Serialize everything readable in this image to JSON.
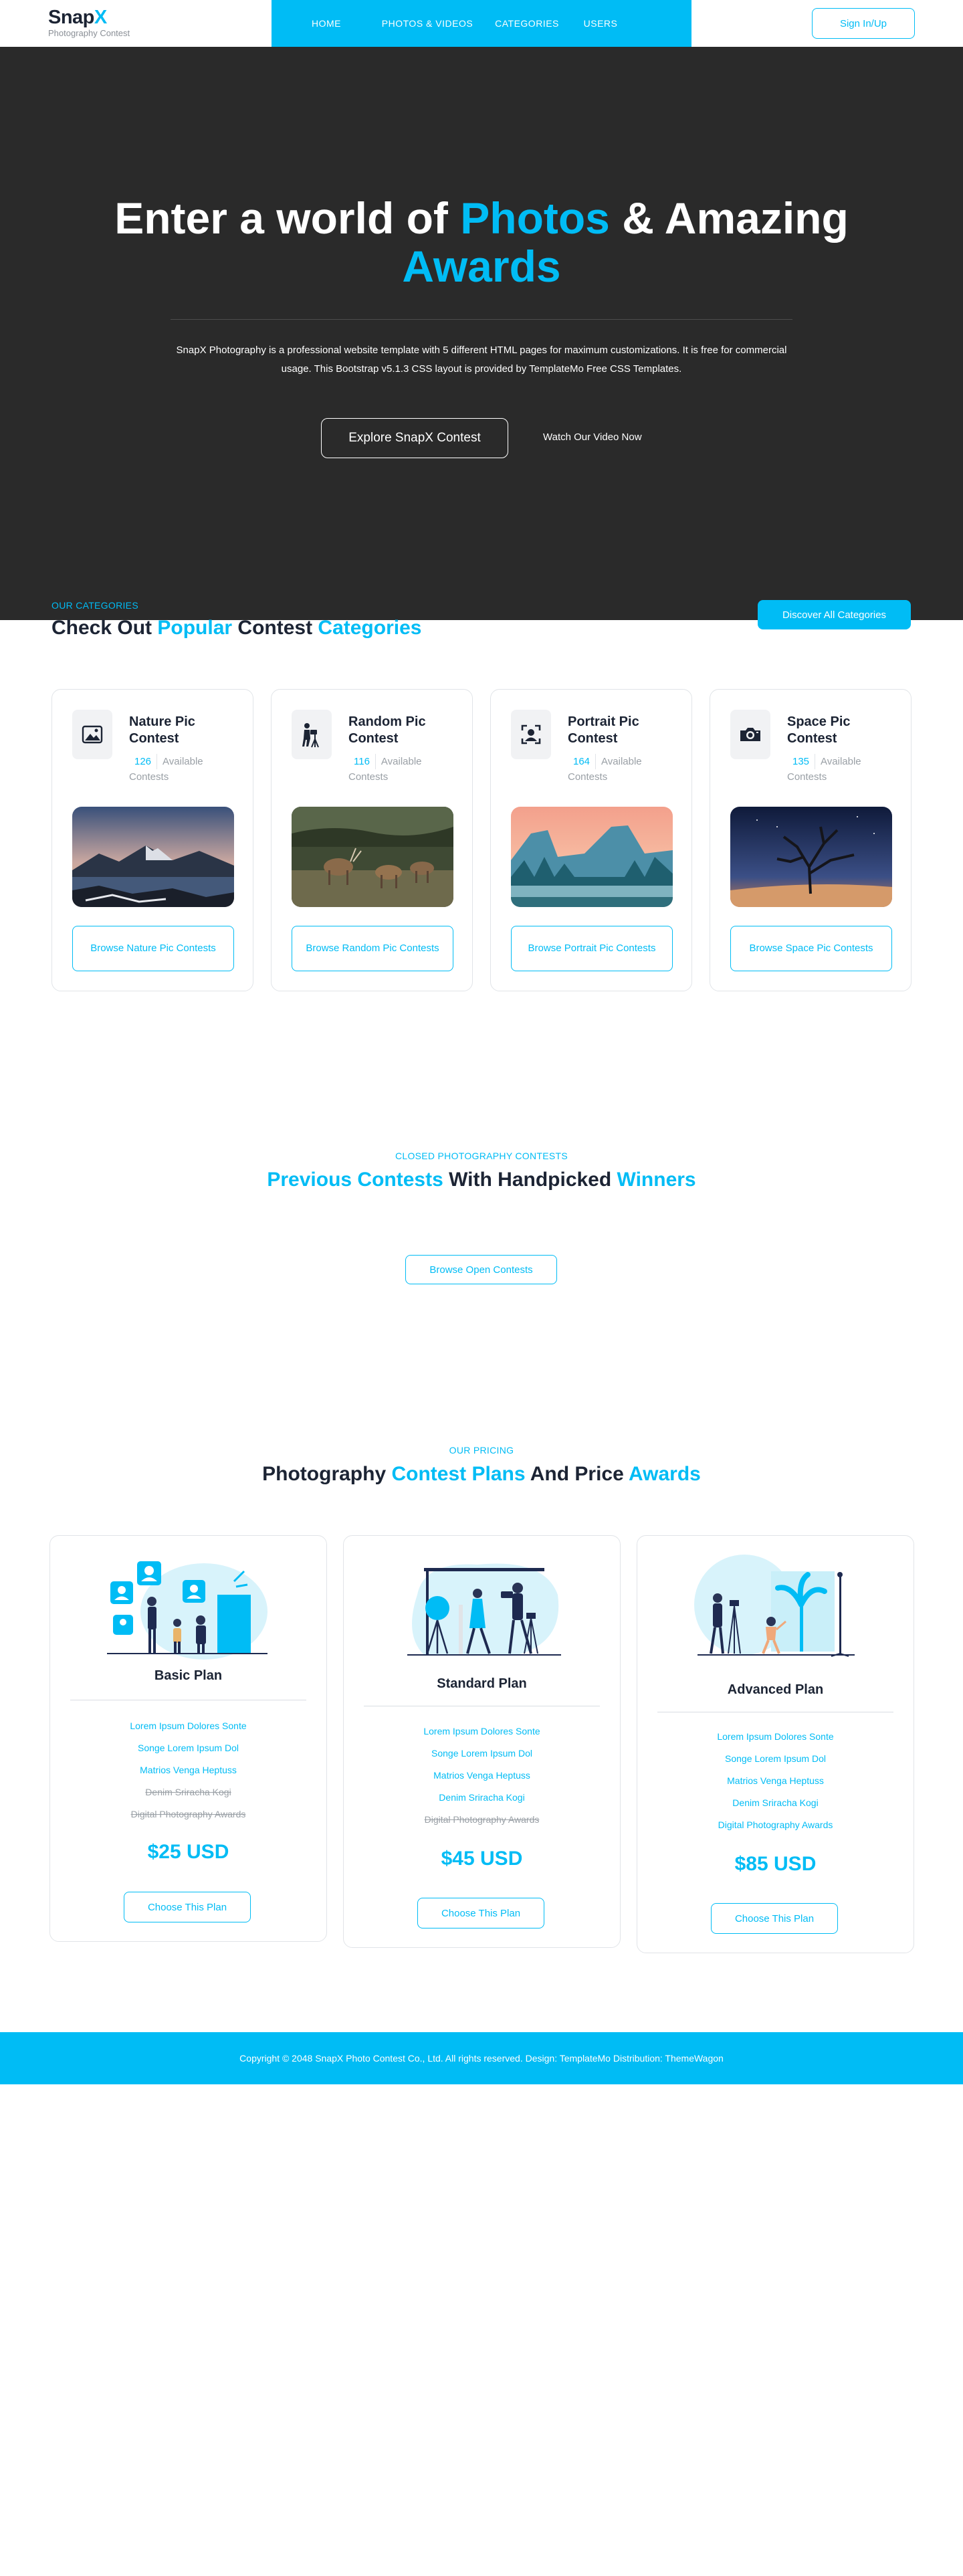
{
  "nav": {
    "brand_main": "Snap",
    "brand_accent": "X",
    "brand_tagline": "Photography Contest",
    "items": [
      {
        "label": "HOME"
      },
      {
        "label": "PHOTOS & VIDEOS"
      },
      {
        "label": "CATEGORIES"
      },
      {
        "label": "USERS"
      }
    ],
    "signin_label": "Sign In/Up"
  },
  "hero": {
    "title_1": "Enter a world of ",
    "title_hl_1": "Photos",
    "title_2": " & Amazing",
    "title_hl_2": "Awards",
    "description": "SnapX Photography is a professional website template with 5 different HTML pages for maximum customizations. It is free for commercial usage. This Bootstrap v5.1.3 CSS layout is provided by TemplateMo Free CSS Templates.",
    "primary_button": "Explore SnapX Contest",
    "video_link": "Watch Our Video Now"
  },
  "categories": {
    "subtitle": "OUR CATEGORIES",
    "title_1": "Check Out ",
    "title_hl_1": "Popular",
    "title_2": " Contest ",
    "title_hl_2": "Categories",
    "discover_button": "Discover All Categories",
    "cards": [
      {
        "title": "Nature Pic Contest",
        "count": "126",
        "count_label": "Available Contests",
        "button": "Browse Nature Pic Contests",
        "icon": "landscape-photo-icon"
      },
      {
        "title": "Random Pic Contest",
        "count": "116",
        "count_label": "Available Contests",
        "button": "Browse Random Pic Contests",
        "icon": "photographer-tripod-icon"
      },
      {
        "title": "Portrait Pic Contest",
        "count": "164",
        "count_label": "Available Contests",
        "button": "Browse Portrait Pic Contests",
        "icon": "portrait-focus-icon"
      },
      {
        "title": "Space Pic Contest",
        "count": "135",
        "count_label": "Available Contests",
        "button": "Browse Space Pic Contests",
        "icon": "camera-icon"
      }
    ]
  },
  "previous": {
    "subtitle": "CLOSED PHOTOGRAPHY CONTESTS",
    "title_hl_1": "Previous Contests",
    "title_2": " With Handpicked ",
    "title_hl_2": "Winners",
    "button": "Browse Open Contests"
  },
  "pricing": {
    "subtitle": "OUR PRICING",
    "title_1": "Photography ",
    "title_hl_1": "Contest Plans",
    "title_2": " And Price ",
    "title_hl_2": "Awards",
    "plans": [
      {
        "name": "Basic Plan",
        "features": [
          {
            "text": "Lorem Ipsum Dolores Sonte",
            "included": true
          },
          {
            "text": "Songe Lorem Ipsum Dol",
            "included": true
          },
          {
            "text": "Matrios Venga Heptuss",
            "included": true
          },
          {
            "text": "Denim Sriracha Kogi",
            "included": false
          },
          {
            "text": "Digital Photography Awards",
            "included": false
          }
        ],
        "price": "$25 USD",
        "button": "Choose This Plan"
      },
      {
        "name": "Standard Plan",
        "features": [
          {
            "text": "Lorem Ipsum Dolores Sonte",
            "included": true
          },
          {
            "text": "Songe Lorem Ipsum Dol",
            "included": true
          },
          {
            "text": "Matrios Venga Heptuss",
            "included": true
          },
          {
            "text": "Denim Sriracha Kogi",
            "included": true
          },
          {
            "text": "Digital Photography Awards",
            "included": false
          }
        ],
        "price": "$45 USD",
        "button": "Choose This Plan"
      },
      {
        "name": "Advanced Plan",
        "features": [
          {
            "text": "Lorem Ipsum Dolores Sonte",
            "included": true
          },
          {
            "text": "Songe Lorem Ipsum Dol",
            "included": true
          },
          {
            "text": "Matrios Venga Heptuss",
            "included": true
          },
          {
            "text": "Denim Sriracha Kogi",
            "included": true
          },
          {
            "text": "Digital Photography Awards",
            "included": true
          }
        ],
        "price": "$85 USD",
        "button": "Choose This Plan"
      }
    ]
  },
  "footer": {
    "text": "Copyright © 2048 SnapX Photo Contest Co., Ltd. All rights reserved. Design: TemplateMo Distribution: ThemeWagon"
  },
  "colors": {
    "accent": "#00bcf5",
    "dark_text": "#1c2434",
    "hero_bg": "#2a2a2a"
  }
}
